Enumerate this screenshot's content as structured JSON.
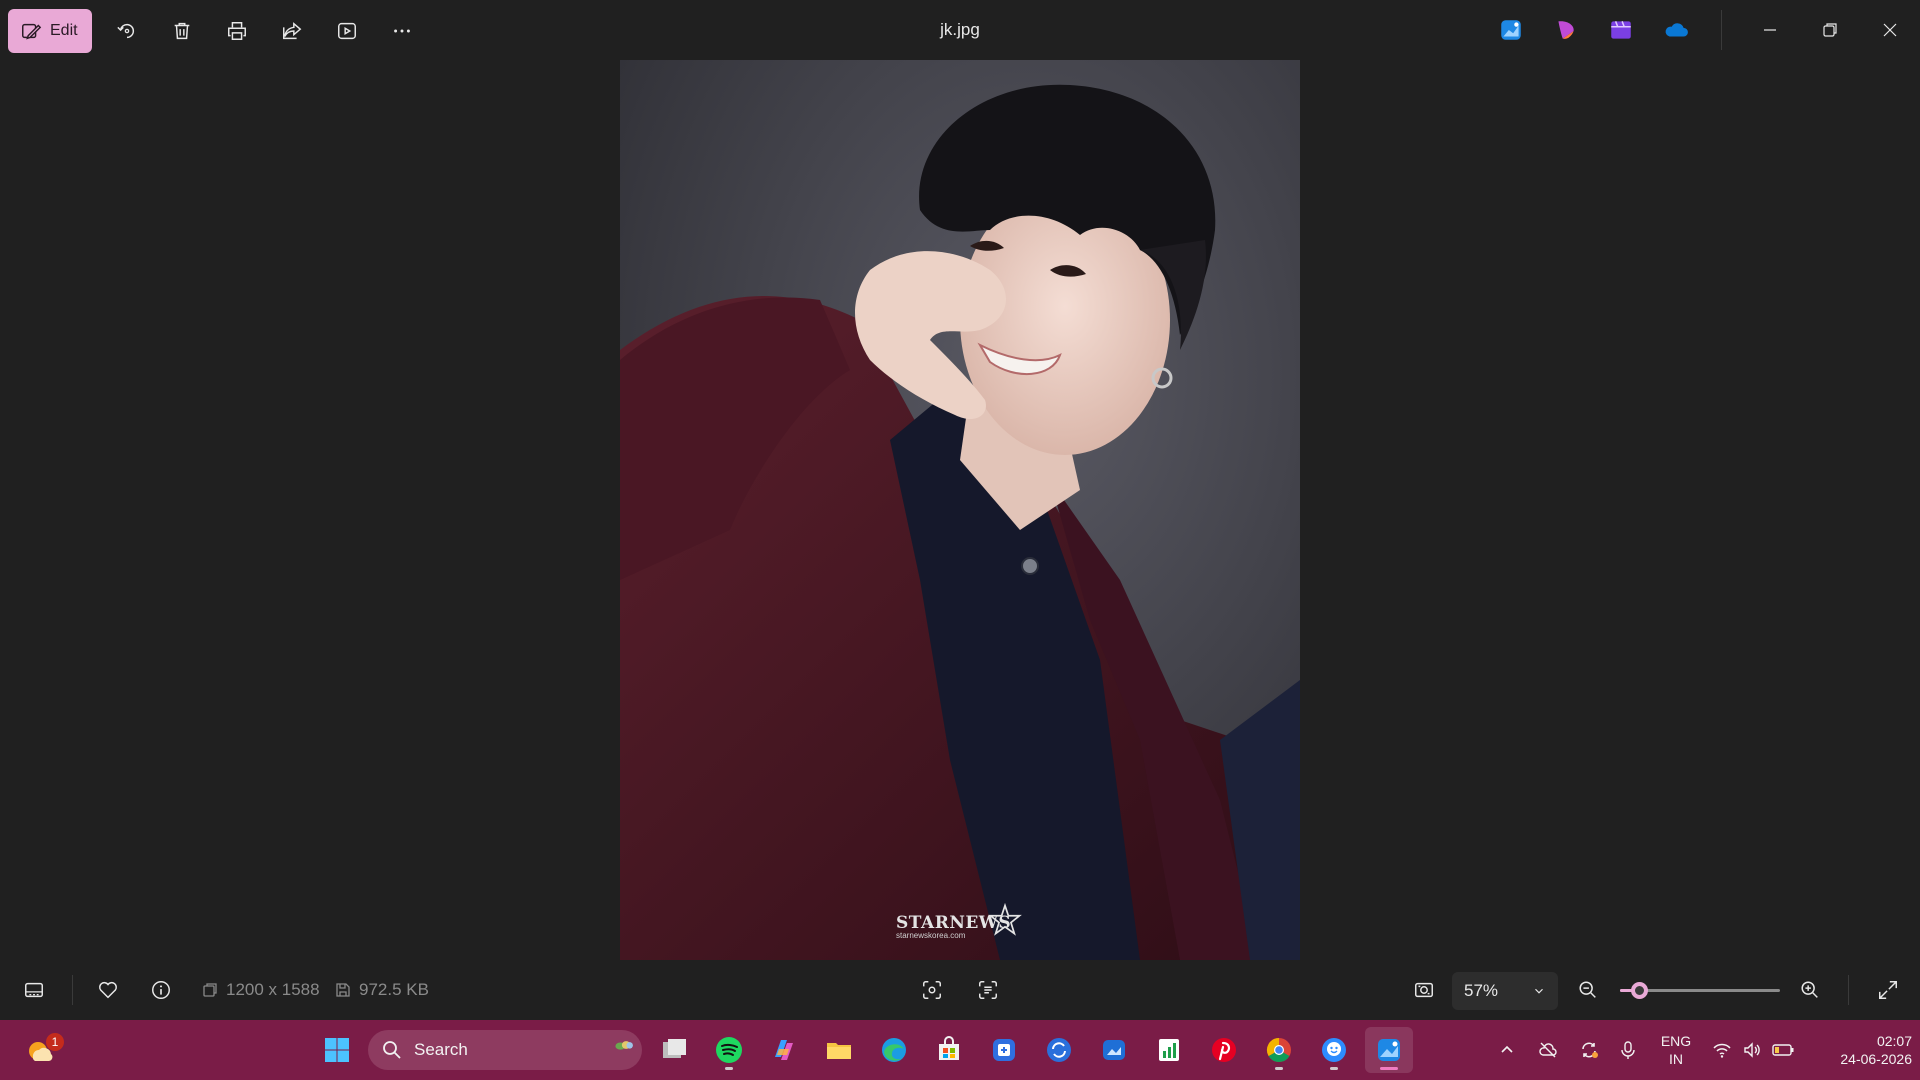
{
  "titlebar": {
    "edit_label": "Edit",
    "file_name": "jk.jpg",
    "tools": [
      "rotate-icon",
      "delete-icon",
      "print-icon",
      "share-icon",
      "slideshow-icon",
      "more-icon"
    ],
    "apps": [
      "photos-app-icon",
      "clipchamp-icon",
      "video-editor-icon",
      "onedrive-icon"
    ],
    "window_controls": [
      "minimize-icon",
      "restore-icon",
      "close-icon"
    ]
  },
  "photo": {
    "watermark": "STARNEWS",
    "watermark_sub": "starnewskorea.com"
  },
  "bottombar": {
    "dimensions": "1200 x 1588",
    "file_size": "972.5 KB",
    "zoom_label": "57%",
    "zoom_level": 0.12
  },
  "taskbar": {
    "search_placeholder": "Search",
    "weather_badge": "1",
    "pinned": [
      "start-icon",
      "task-view-icon",
      "spotify-icon",
      "copilot-icon",
      "file-explorer-icon",
      "edge-icon",
      "store-icon",
      "teams-icon",
      "sync-app-icon",
      "photos-sync-icon",
      "sheets-icon",
      "pinterest-icon",
      "chrome-icon",
      "messenger-icon",
      "photos-icon"
    ],
    "lang_top": "ENG",
    "lang_bottom": "IN",
    "time": "02:07",
    "date": "24-06-2026"
  },
  "colors": {
    "accent": "#e9a9d6",
    "taskbar": "#7a1c47",
    "background": "#202020"
  }
}
